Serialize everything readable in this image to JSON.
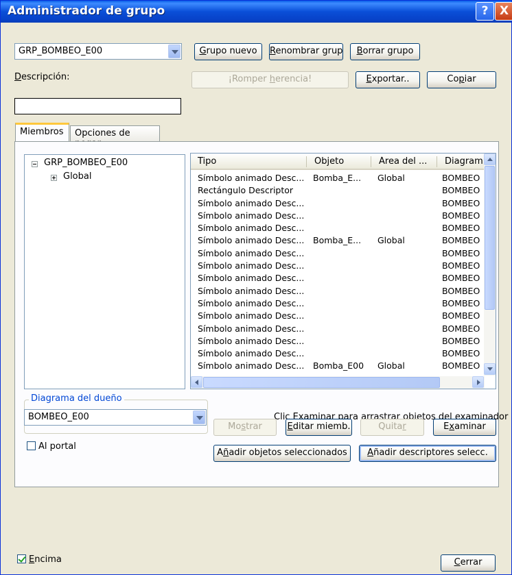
{
  "window": {
    "title": "Administrador de grupo",
    "help_glyph": "?",
    "close_glyph": "X"
  },
  "group_combo": {
    "value": "GRP_BOMBEO_E00"
  },
  "buttons": {
    "grupo_nuevo": {
      "pre": "",
      "accel": "G",
      "post": "rupo nuevo"
    },
    "renombrar": {
      "pre": "",
      "accel": "R",
      "post": "enombrar grupo"
    },
    "borrar": {
      "pre": "",
      "accel": "B",
      "post": "orrar grupo"
    },
    "romper": {
      "pre": "¡Romper ",
      "accel": "h",
      "post": "erencia!"
    },
    "exportar": {
      "pre": "",
      "accel": "E",
      "post": "xportar.."
    },
    "copiar": {
      "pre": "Co",
      "accel": "p",
      "post": "iar"
    },
    "mostrar": {
      "pre": "Mo",
      "accel": "s",
      "post": "trar"
    },
    "editar": {
      "pre": "",
      "accel": "E",
      "post": "ditar miemb."
    },
    "quitar": {
      "pre": "Quita",
      "accel": "r",
      "post": ""
    },
    "examinar": {
      "pre": "E",
      "accel": "x",
      "post": "aminar"
    },
    "anadir_objetos": {
      "pre": "A",
      "accel": "ñ",
      "post": "adir objetos seleccionados"
    },
    "anadir_descriptores": {
      "pre": "",
      "accel": "A",
      "post": "ñadir descriptores selecc."
    },
    "cerrar": {
      "pre": "",
      "accel": "C",
      "post": "errar"
    }
  },
  "descripcion": {
    "pre": "",
    "accel": "D",
    "post": "escripción:",
    "value": ""
  },
  "tabs": [
    {
      "label": "Miembros"
    },
    {
      "label": "Opciones de pegar"
    }
  ],
  "tree": {
    "root": "GRP_BOMBEO_E00",
    "child": "Global"
  },
  "member_list": {
    "columns": [
      "Tipo",
      "Objeto",
      "Área del ...",
      "Diagram"
    ],
    "rows": [
      [
        "Símbolo animado Desc...",
        "Bomba_E...",
        "Global",
        "BOMBEO"
      ],
      [
        "Rectángulo Descriptor",
        "",
        "",
        "BOMBEO"
      ],
      [
        "Símbolo animado Desc...",
        "",
        "",
        "BOMBEO"
      ],
      [
        "Símbolo animado Desc...",
        "",
        "",
        "BOMBEO"
      ],
      [
        "Símbolo animado Desc...",
        "",
        "",
        "BOMBEO"
      ],
      [
        "Símbolo animado Desc...",
        "Bomba_E...",
        "Global",
        "BOMBEO"
      ],
      [
        "Símbolo animado Desc...",
        "",
        "",
        "BOMBEO"
      ],
      [
        "Símbolo animado Desc...",
        "",
        "",
        "BOMBEO"
      ],
      [
        "Símbolo animado Desc...",
        "",
        "",
        "BOMBEO"
      ],
      [
        "Símbolo animado Desc...",
        "",
        "",
        "BOMBEO"
      ],
      [
        "Símbolo animado Desc...",
        "",
        "",
        "BOMBEO"
      ],
      [
        "Símbolo animado Desc...",
        "",
        "",
        "BOMBEO"
      ],
      [
        "Símbolo animado Desc...",
        "",
        "",
        "BOMBEO"
      ],
      [
        "Símbolo animado Desc...",
        "",
        "",
        "BOMBEO"
      ],
      [
        "Símbolo animado Desc...",
        "",
        "",
        "BOMBEO"
      ],
      [
        "Símbolo animado Desc...",
        "Bomba_E00",
        "Global",
        "BOMBEO"
      ]
    ]
  },
  "owner_diagram": {
    "legend": "Diagrama del dueño",
    "value": "BOMBEO_E00"
  },
  "hint": "Clic Examinar para arrastrar objetos del examinador",
  "al_portal": {
    "label": "Al portal",
    "checked": false
  },
  "encima": {
    "pre": "",
    "accel": "E",
    "post": "ncima",
    "checked": true
  },
  "colors": {
    "title_bar": "#0a4fd8",
    "tab_highlight": "#ffc73c",
    "group_legend": "#0046d5",
    "disabled_text": "#aca899"
  }
}
